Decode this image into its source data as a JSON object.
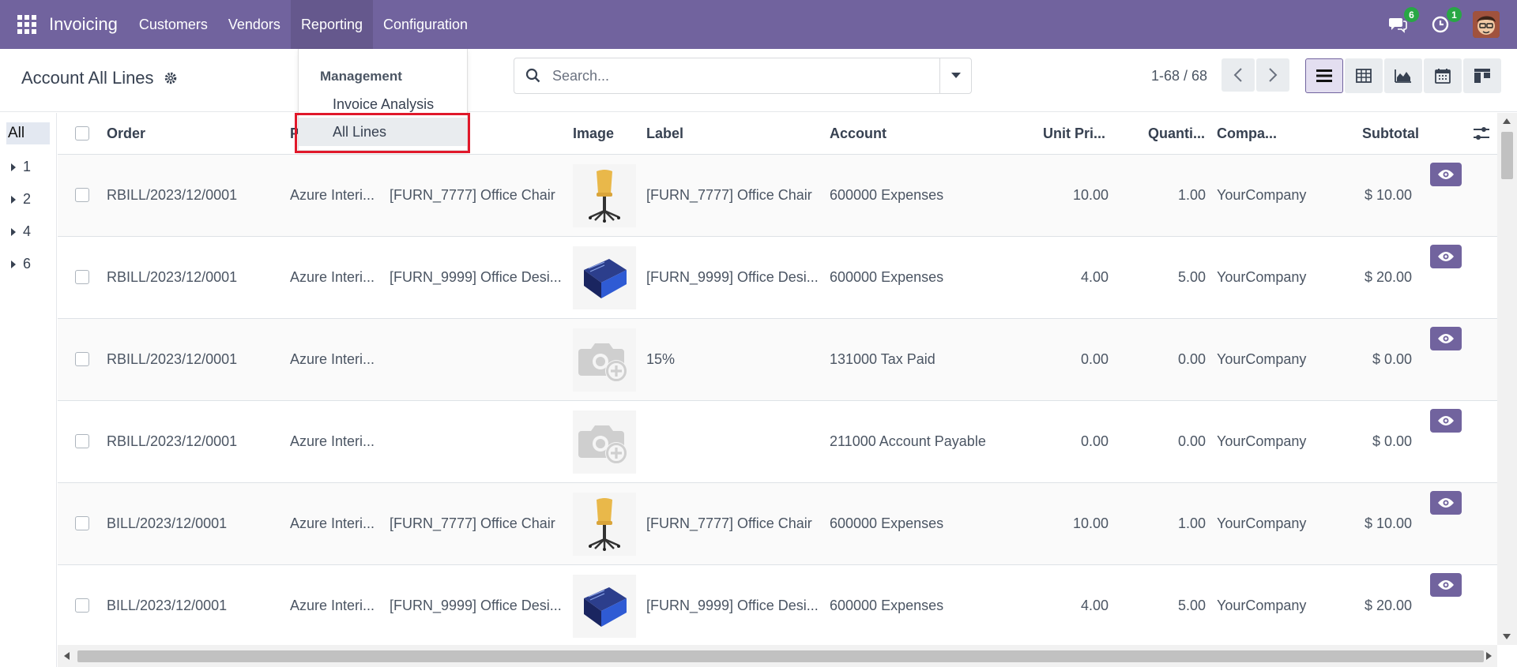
{
  "navbar": {
    "brand": "Invoicing",
    "menu": [
      "Customers",
      "Vendors",
      "Reporting",
      "Configuration"
    ],
    "messages_count": "6",
    "activities_count": "1"
  },
  "control": {
    "title": "Account All Lines",
    "search_placeholder": "Search...",
    "pager": "1-68 / 68"
  },
  "dropdown": {
    "header": "Management",
    "items": [
      "Invoice Analysis",
      "All Lines"
    ]
  },
  "sidepanel": {
    "items": [
      "All",
      "1",
      "2",
      "4",
      "6"
    ]
  },
  "table": {
    "columns": [
      "Order",
      "P",
      "Image",
      "Label",
      "Account",
      "Unit Pri...",
      "Quanti...",
      "Compa...",
      "Subtotal"
    ],
    "rows": [
      {
        "order": "RBILL/2023/12/0001",
        "partner": "Azure Interi...",
        "product": "[FURN_7777] Office Chair",
        "image": "chair-image",
        "label": "[FURN_7777] Office Chair",
        "account": "600000 Expenses",
        "unit_price": "10.00",
        "quantity": "1.00",
        "company": "YourCompany",
        "subtotal": "$ 10.00"
      },
      {
        "order": "RBILL/2023/12/0001",
        "partner": "Azure Interi...",
        "product": "[FURN_9999] Office Desi...",
        "image": "book-image",
        "label": "[FURN_9999] Office Desi...",
        "account": "600000 Expenses",
        "unit_price": "4.00",
        "quantity": "5.00",
        "company": "YourCompany",
        "subtotal": "$ 20.00"
      },
      {
        "order": "RBILL/2023/12/0001",
        "partner": "Azure Interi...",
        "product": "",
        "image": "placeholder-camera-icon",
        "label": "15%",
        "account": "131000 Tax Paid",
        "unit_price": "0.00",
        "quantity": "0.00",
        "company": "YourCompany",
        "subtotal": "$ 0.00"
      },
      {
        "order": "RBILL/2023/12/0001",
        "partner": "Azure Interi...",
        "product": "",
        "image": "placeholder-camera-icon",
        "label": "",
        "account": "211000 Account Payable",
        "unit_price": "0.00",
        "quantity": "0.00",
        "company": "YourCompany",
        "subtotal": "$ 0.00"
      },
      {
        "order": "BILL/2023/12/0001",
        "partner": "Azure Interi...",
        "product": "[FURN_7777] Office Chair",
        "image": "chair-image",
        "label": "[FURN_7777] Office Chair",
        "account": "600000 Expenses",
        "unit_price": "10.00",
        "quantity": "1.00",
        "company": "YourCompany",
        "subtotal": "$ 10.00"
      },
      {
        "order": "BILL/2023/12/0001",
        "partner": "Azure Interi...",
        "product": "[FURN_9999] Office Desi...",
        "image": "book-image",
        "label": "[FURN_9999] Office Desi...",
        "account": "600000 Expenses",
        "unit_price": "4.00",
        "quantity": "5.00",
        "company": "YourCompany",
        "subtotal": "$ 20.00"
      }
    ]
  },
  "colors": {
    "brand": "#71639e",
    "highlight": "#e0182a",
    "badge": "#28a745"
  }
}
